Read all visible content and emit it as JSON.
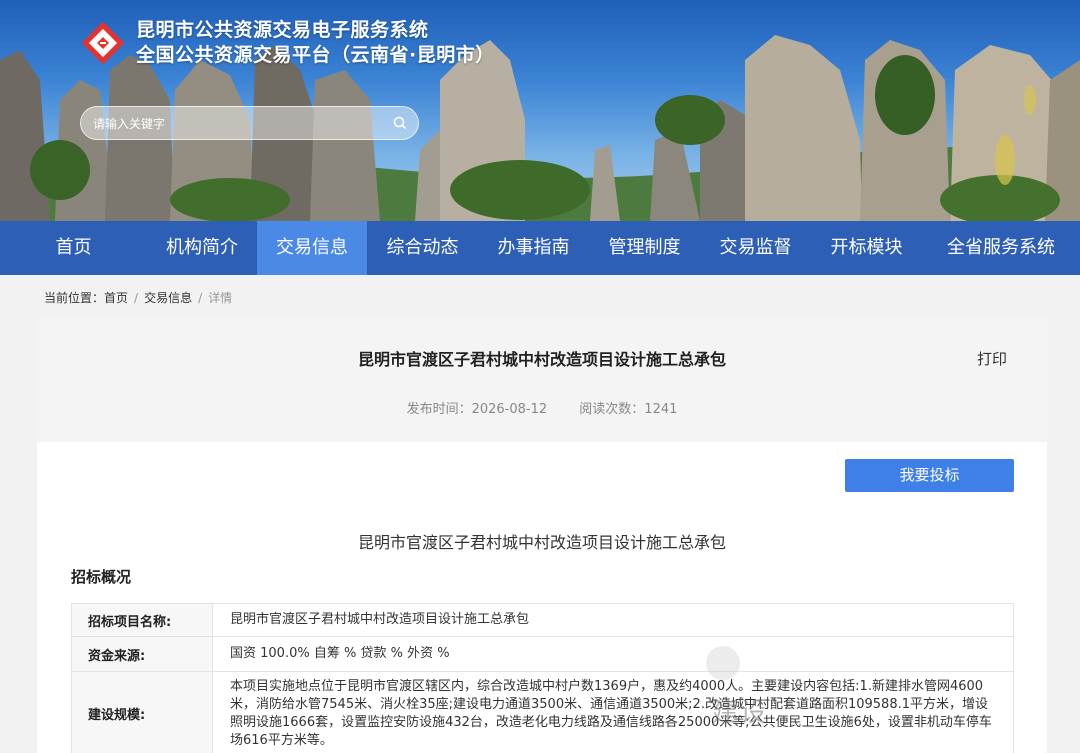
{
  "header": {
    "title": "昆明市公共资源交易电子服务系统",
    "subtitle": "全国公共资源交易平台（云南省·昆明市）",
    "logo_icon": "logo-icon",
    "brand_color": "#e5322d"
  },
  "search": {
    "placeholder": "请输入关键字",
    "icon": "search-icon"
  },
  "nav": {
    "items": [
      {
        "label": "首页"
      },
      {
        "label": "机构简介"
      },
      {
        "label": "交易信息"
      },
      {
        "label": "综合动态"
      },
      {
        "label": "办事指南"
      },
      {
        "label": "管理制度"
      },
      {
        "label": "交易监督"
      },
      {
        "label": "开标模块"
      },
      {
        "label": "全省服务系统"
      }
    ],
    "active_index": 2,
    "bg_color": "#2d5fb6",
    "active_color": "#4a8ae6"
  },
  "breadcrumb": {
    "prefix": "当前位置：",
    "items": [
      "首页",
      "交易信息",
      "详情"
    ],
    "separator": "/"
  },
  "article": {
    "title": "昆明市官渡区子君村城中村改造项目设计施工总承包",
    "print_label": "打印",
    "publish_label": "发布时间：2026-08-12",
    "views_label": "阅读次数：1241",
    "bid_button": "我要投标",
    "subtitle": "昆明市官渡区子君村城中村改造项目设计施工总承包",
    "section_title": "招标概况"
  },
  "info_table": {
    "rows": [
      {
        "key": "招标项目名称:",
        "value": "昆明市官渡区子君村城中村改造项目设计施工总承包"
      },
      {
        "key": "资金来源:",
        "value": "国资 100.0% 自筹 % 贷款 % 外资 %"
      },
      {
        "key": "建设规模:",
        "value": "本项目实施地点位于昆明市官渡区辖区内，综合改造城中村户数1369户，惠及约4000人。主要建设内容包括:1.新建排水管网4600米，消防给水管7545米、消火栓35座;建设电力通道3500米、通信通道3500米;2.改造城中村配套道路面积109588.1平方米，增设照明设施1666套，设置监控安防设施432台，改造老化电力线路及通信线路各25000米等;公共便民卫生设施6处，设置非机动车停车场616平方米等。"
      }
    ]
  },
  "watermark": {
    "text": "建设"
  }
}
